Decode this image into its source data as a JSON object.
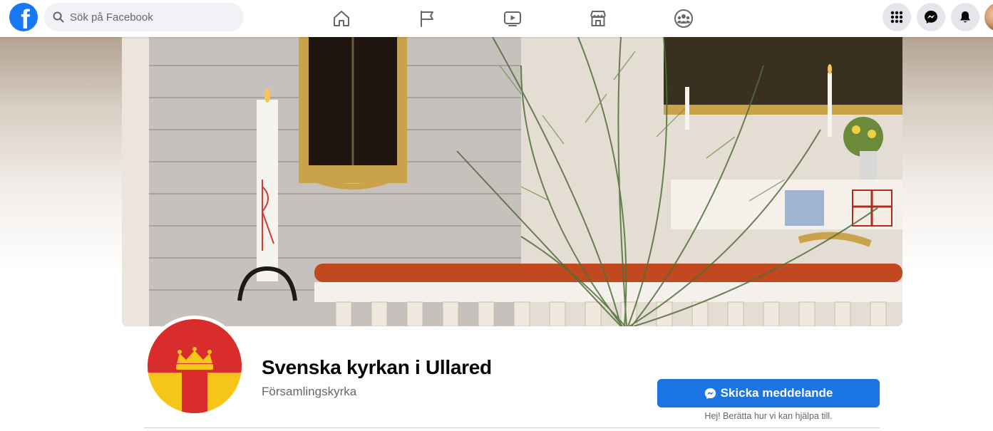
{
  "topbar": {
    "logo_letter": "f",
    "search_placeholder": "Sök på Facebook",
    "nav": [
      {
        "name": "home"
      },
      {
        "name": "pages"
      },
      {
        "name": "watch"
      },
      {
        "name": "marketplace"
      },
      {
        "name": "groups"
      }
    ],
    "right_buttons": [
      {
        "name": "menu-grid"
      },
      {
        "name": "messenger"
      },
      {
        "name": "notifications"
      }
    ]
  },
  "page": {
    "name": "Svenska kyrkan i Ullared",
    "category": "Församlingskyrka",
    "message_button": "Skicka meddelande",
    "message_hint": "Hej! Berätta hur vi kan hjälpa till."
  },
  "colors": {
    "facebook_blue": "#1877f2",
    "button_blue": "#1b74e4",
    "logo_red": "#d92d2d",
    "logo_yellow": "#f5c518"
  }
}
